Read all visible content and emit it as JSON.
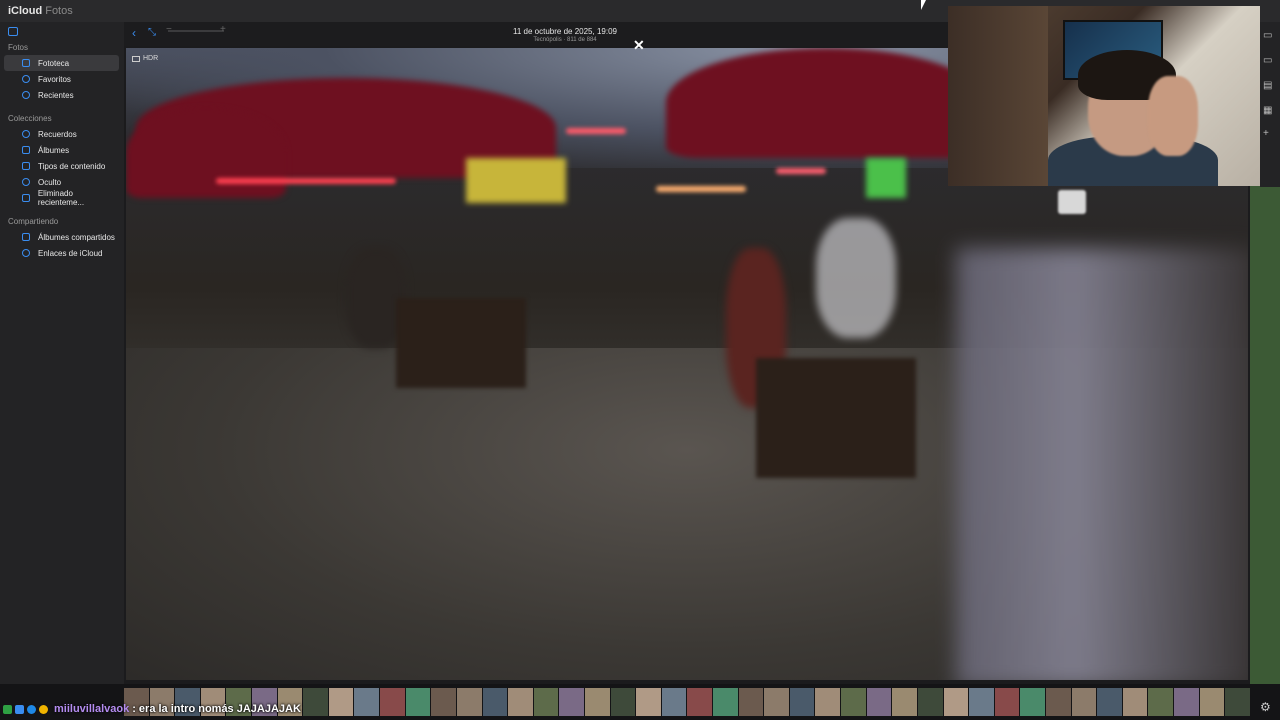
{
  "app": {
    "brand": "iCloud",
    "section": "Fotos"
  },
  "sidebar": {
    "sections": [
      {
        "title": "Fotos",
        "items": [
          "Fototeca",
          "Favoritos",
          "Recientes"
        ]
      },
      {
        "title": "Colecciones",
        "items": [
          "Recuerdos",
          "Álbumes",
          "Tipos de contenido",
          "Oculto",
          "Eliminado recienteme..."
        ]
      },
      {
        "title": "Compartiendo",
        "items": [
          "Álbumes compartidos",
          "Enlaces de iCloud"
        ]
      }
    ]
  },
  "photo": {
    "date": "11 de octubre de 2025, 19:09",
    "subtitle": "Tecnópolis · 811 de 884",
    "hdr_label": "HDR"
  },
  "chat": {
    "username": "miiluvillalvaok",
    "message": ": era la intro nomás JAJAJAJAK"
  },
  "colors": {
    "accent": "#3a8df0",
    "chat_user": "#b48cf0"
  }
}
